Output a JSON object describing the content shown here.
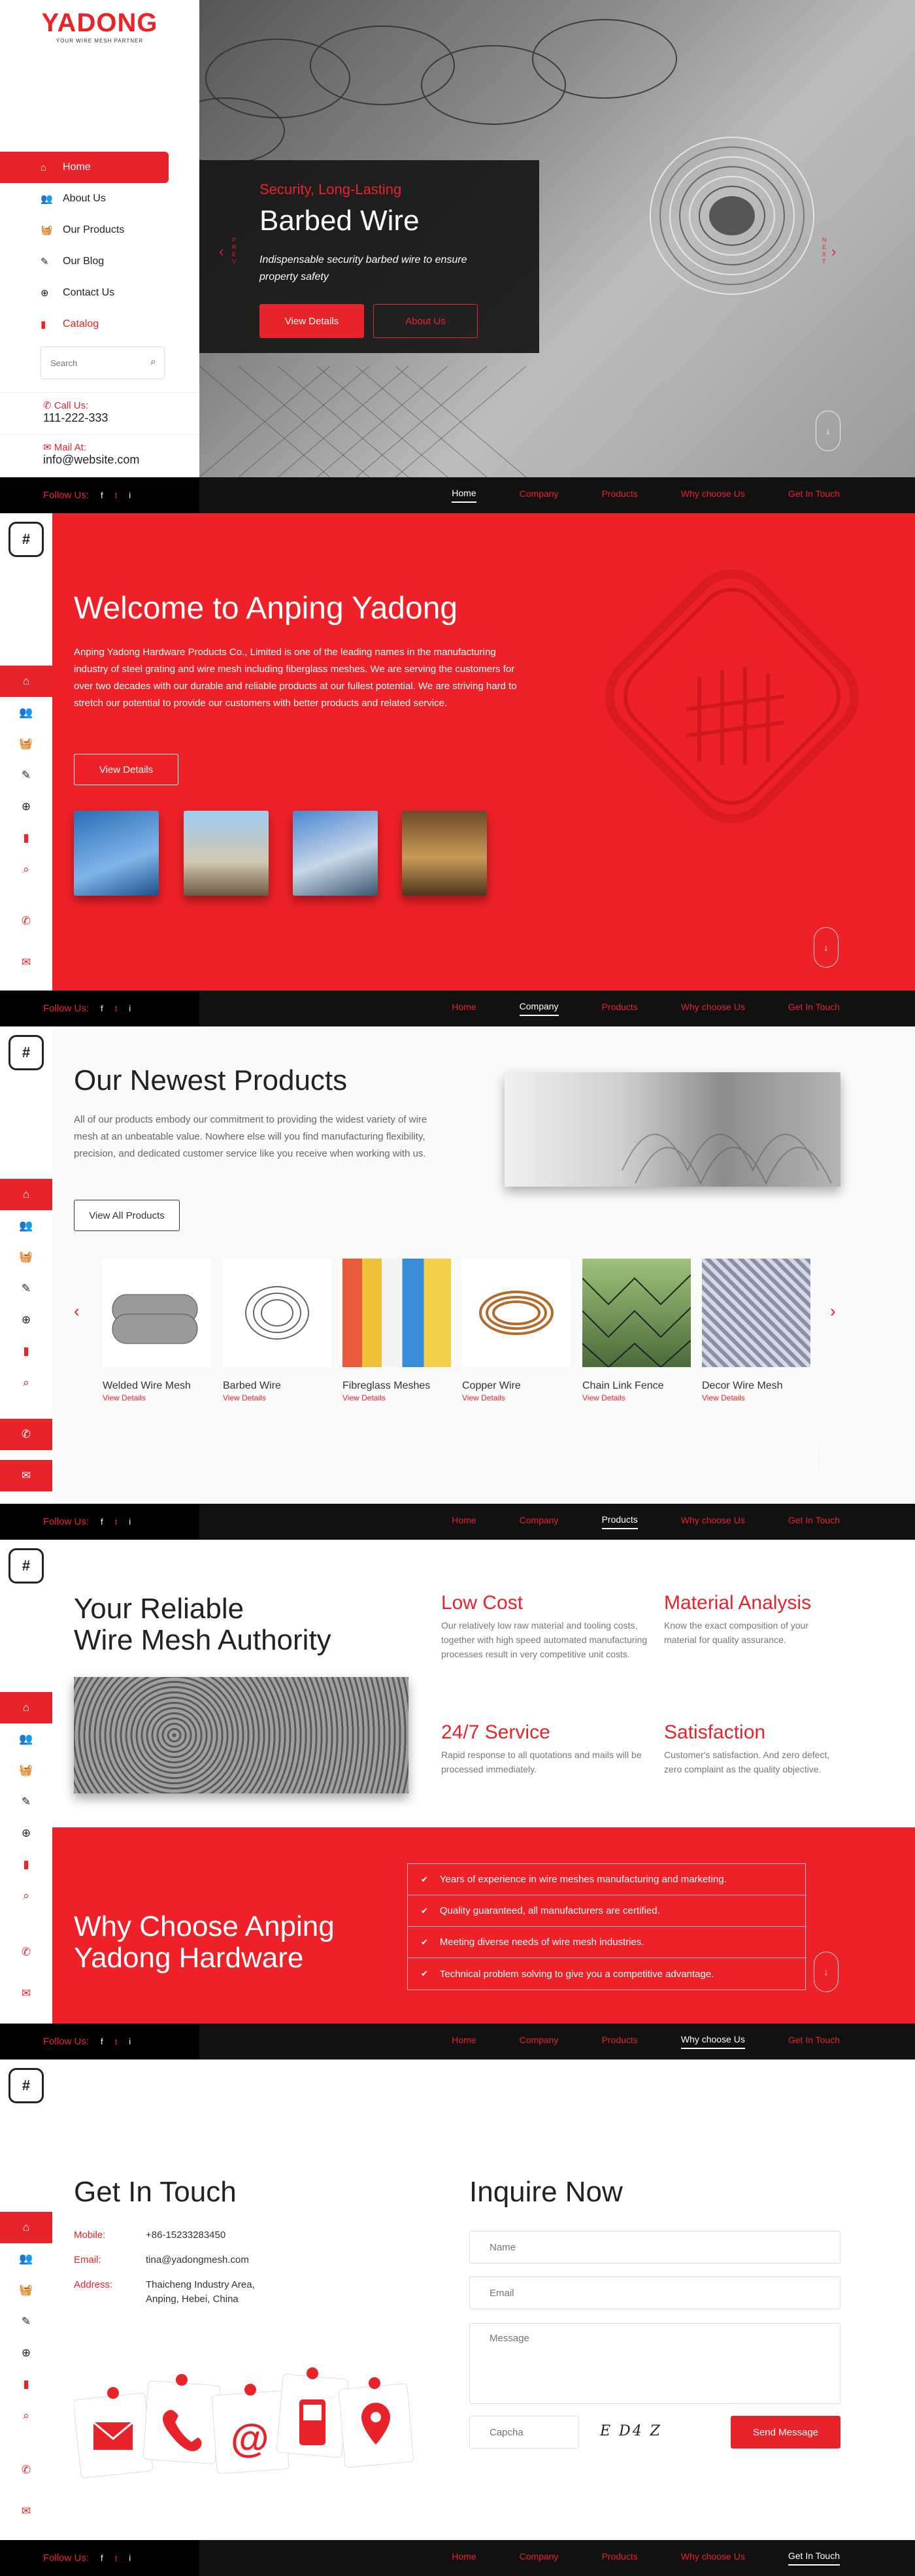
{
  "logo": {
    "text": "YADONG",
    "tagline": "YOUR WIRE MESH PARTNER"
  },
  "nav": [
    {
      "label": "Home",
      "icon": "home-icon"
    },
    {
      "label": "About Us",
      "icon": "users-icon"
    },
    {
      "label": "Our Products",
      "icon": "basket-icon"
    },
    {
      "label": "Our Blog",
      "icon": "blog-icon"
    },
    {
      "label": "Contact Us",
      "icon": "support-icon"
    },
    {
      "label": "Catalog",
      "icon": "pdf-icon"
    }
  ],
  "search": {
    "placeholder": "Search"
  },
  "sidebar_contact": {
    "call_label": "Call Us:",
    "call_value": "111-222-333",
    "mail_label": "Mail At:",
    "mail_value": "info@website.com"
  },
  "footer": {
    "follow": "Follow Us:",
    "social": [
      "f",
      "t",
      "i"
    ],
    "nav": [
      "Home",
      "Company",
      "Products",
      "Why choose Us",
      "Get In Touch"
    ]
  },
  "hero": {
    "kicker": "Security, Long-Lasting",
    "title": "Barbed Wire",
    "desc": "Indispensable security barbed wire to ensure property safety",
    "btn_details": "View Details",
    "btn_about": "About Us",
    "prev": "PREV",
    "next": "NEXT"
  },
  "welcome": {
    "title": "Welcome to Anping Yadong",
    "text": "Anping Yadong Hardware Products Co., Limited is one of the leading names in the manufacturing industry of steel grating and wire mesh including fiberglass meshes. We are serving the customers for over two decades with our durable and reliable products at our fullest potential. We are striving hard to stretch our potential to provide our customers with better products and related service.",
    "btn": "View Details"
  },
  "products": {
    "title": "Our Newest Products",
    "text": "All of our products embody our commitment to providing the widest variety of wire mesh at an unbeatable value. Nowhere else will you find manufacturing flexibility, precision, and dedicated customer service like you receive when working with us.",
    "btn": "View All Products",
    "link_label": "View Details",
    "items": [
      {
        "name": "Welded Wire Mesh"
      },
      {
        "name": "Barbed Wire"
      },
      {
        "name": "Fibreglass Meshes"
      },
      {
        "name": "Copper Wire"
      },
      {
        "name": "Chain Link Fence"
      },
      {
        "name": "Decor Wire Mesh"
      }
    ]
  },
  "authority": {
    "title_line1": "Your Reliable",
    "title_line2": "Wire Mesh Authority",
    "features": [
      {
        "title": "Low Cost",
        "text": "Our relatively low raw material and tooling costs, together with high speed automated manufacturing processes result in very competitive unit costs."
      },
      {
        "title": "Material Analysis",
        "text": "Know the exact composition of your material for quality assurance."
      },
      {
        "title": "24/7 Service",
        "text": "Rapid response to all quotations and mails will be processed immediately."
      },
      {
        "title": "Satisfaction",
        "text": "Customer's satisfaction. And zero defect, zero complaint as the quality objective."
      }
    ]
  },
  "why": {
    "title_line1": "Why Choose Anping",
    "title_line2": "Yadong Hardware",
    "points": [
      "Years of experience in wire meshes manufacturing and marketing.",
      "Quality guaranteed, all manufacturers are certified.",
      "Meeting diverse needs of wire mesh industries.",
      "Technical problem solving to give you a competitive advantage."
    ]
  },
  "contact": {
    "title": "Get In Touch",
    "mobile_label": "Mobile:",
    "mobile_value": "+86-15233283450",
    "email_label": "Email:",
    "email_value": "tina@yadongmesh.com",
    "address_label": "Address:",
    "address_line1": "Thaicheng Industry Area,",
    "address_line2": "Anping, Hebei, China"
  },
  "inquire": {
    "title": "Inquire Now",
    "name_ph": "Name",
    "email_ph": "Email",
    "message_ph": "Message",
    "captcha_ph": "Capcha",
    "captcha_code": "E D4 Z",
    "btn": "Send Message"
  },
  "colors": {
    "accent": "#e8232a",
    "dark": "#111111"
  }
}
